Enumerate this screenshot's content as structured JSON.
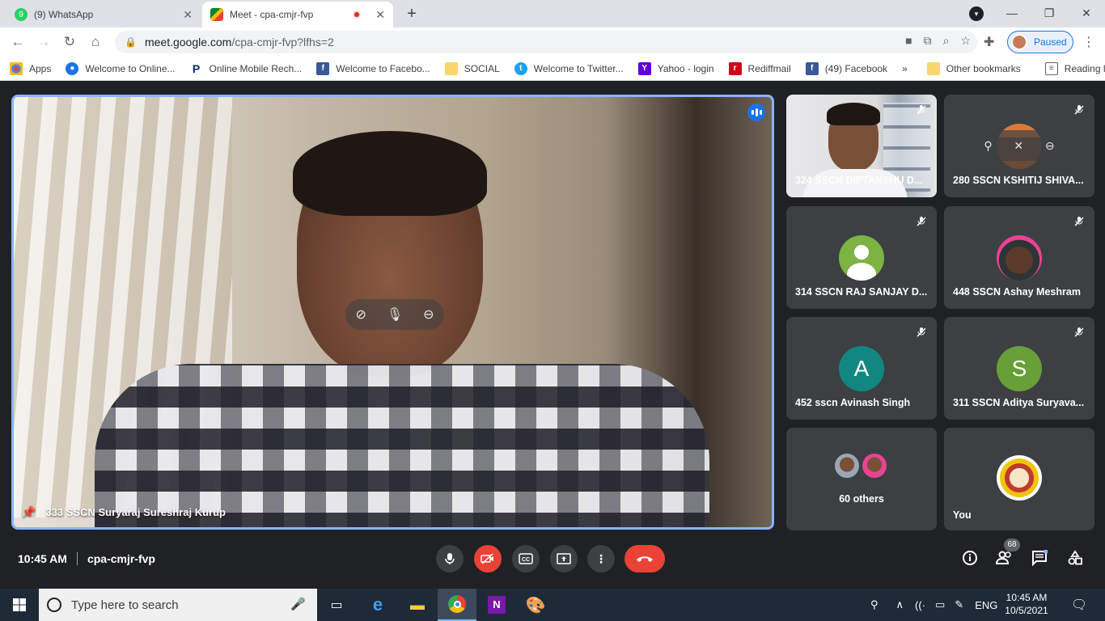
{
  "browser": {
    "tabs": [
      {
        "label": "(9) WhatsApp",
        "icon": "whatsapp-icon",
        "active": false
      },
      {
        "label": "Meet - cpa-cmjr-fvp",
        "icon": "meet-icon",
        "active": true
      }
    ],
    "url_host": "meet.google.com",
    "url_path": "/cpa-cmjr-fvp?lfhs=2",
    "profile_label": "Paused",
    "bookmarks": [
      {
        "label": "Apps",
        "icon": "apps-grid-icon"
      },
      {
        "label": "Welcome to Online...",
        "icon": "globe-icon"
      },
      {
        "label": "Online Mobile Rech...",
        "icon": "paytm-icon"
      },
      {
        "label": "Welcome to Facebo...",
        "icon": "facebook-icon"
      },
      {
        "label": "SOCIAL",
        "icon": "folder-icon"
      },
      {
        "label": "Welcome to Twitter...",
        "icon": "twitter-icon"
      },
      {
        "label": "Yahoo - login",
        "icon": "yahoo-icon"
      },
      {
        "label": "Rediffmail",
        "icon": "rediff-icon"
      },
      {
        "label": "(49) Facebook",
        "icon": "facebook-icon"
      }
    ],
    "bookmarks_overflow": "»",
    "other_bookmarks": "Other bookmarks",
    "reading_list": "Reading list"
  },
  "meet": {
    "main": {
      "name": "333 SSCN Suryaraj Sureshraj Kurup"
    },
    "tiles": [
      {
        "name": "324 SSCN DIPTANSHU D...",
        "type": "video"
      },
      {
        "name": "280 SSCN KSHITIJ SHIVA...",
        "type": "photo-hover"
      },
      {
        "name": "314 SSCN RAJ SANJAY D...",
        "type": "default-avatar"
      },
      {
        "name": "448 SSCN Ashay Meshram",
        "type": "photo"
      },
      {
        "name": "452 sscn Avinash Singh",
        "type": "letter",
        "letter": "A",
        "color": "#12877f"
      },
      {
        "name": "311 SSCN Aditya Suryava...",
        "type": "letter",
        "letter": "S",
        "color": "#689f38"
      }
    ],
    "others_label": "60 others",
    "you_label": "You",
    "time": "10:45 AM",
    "meeting_code": "cpa-cmjr-fvp",
    "participant_count": "68"
  },
  "taskbar": {
    "search_placeholder": "Type here to search",
    "language": "ENG",
    "time": "10:45 AM",
    "date": "10/5/2021"
  },
  "colors": {
    "accent": "#8ab4f8",
    "end_call": "#ea4335",
    "meet_bg": "#202124",
    "tile_bg": "#3c4043"
  }
}
